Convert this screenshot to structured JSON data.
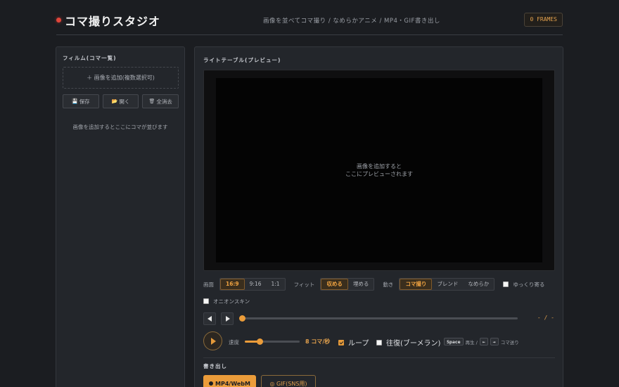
{
  "header": {
    "title": "コマ撮りスタジオ",
    "subtitle": "画像を並べてコマ撮り / なめらかアニメ / MP4・GIF書き出し",
    "frames_badge": "0 FRAMES",
    "accent_color": "#eb9c3a",
    "record_dot_color": "#e0453a"
  },
  "film": {
    "title": "フィルム(コマ一覧)",
    "add_label": "＋ 画像を追加(複数選択可)",
    "buttons": [
      {
        "icon": "save-icon",
        "glyph": "💾",
        "label": "保存"
      },
      {
        "icon": "folder-icon",
        "glyph": "📂",
        "label": "開く"
      },
      {
        "icon": "trash-icon",
        "glyph": "🗑",
        "label": "全消去"
      }
    ],
    "empty_message": "画像を追加するとここにコマが並びます"
  },
  "preview": {
    "title": "ライトテーブル(プレビュー)",
    "stage_line1": "画像を追加すると",
    "stage_line2": "ここにプレビューされます"
  },
  "controls": {
    "screen_label": "画面",
    "screen_options": [
      "16:9",
      "9:16",
      "1:1"
    ],
    "screen_selected": "16:9",
    "fit_label": "フィット",
    "fit_options": [
      "収める",
      "埋める"
    ],
    "fit_selected": "収める",
    "motion_label": "動き",
    "motion_options": [
      "コマ撮り",
      "ブレンド",
      "なめらか"
    ],
    "motion_selected": "コマ撮り",
    "ease_label": "ゆっくり寄る",
    "ease_checked": false,
    "onion_label": "オニオンスキン",
    "onion_checked": false
  },
  "timeline": {
    "counter": "- / -",
    "position": 0
  },
  "playback": {
    "speed_label": "速度",
    "speed_value": "8 コマ/秒",
    "speed_fraction": 0.27,
    "loop_label": "ループ",
    "loop_checked": true,
    "pingpong_label": "往復(ブーメラン)",
    "pingpong_checked": false,
    "key_space": "Space",
    "key_space_hint": "再生 /",
    "key_left": "←",
    "key_right": "→",
    "key_arrow_hint": "コマ送り"
  },
  "export": {
    "title": "書き出し",
    "mp4_label": "MP4/WebM",
    "gif_label": "◎ GIF(SNS用)"
  }
}
